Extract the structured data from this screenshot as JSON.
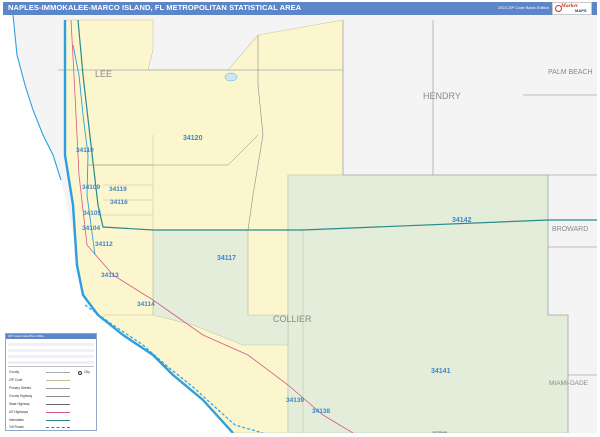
{
  "header": {
    "title": "NAPLES-IMMOKALEE-MARCO ISLAND, FL METROPOLITAN STATISTICAL AREA",
    "edition": "2023 ZIP Code Basic Edition",
    "logo_top": "Market",
    "logo_bottom": "MAPS"
  },
  "counties": {
    "lee": "LEE",
    "hendry": "HENDRY",
    "palm_beach": "PALM BEACH",
    "broward": "BROWARD",
    "collier": "COLLIER",
    "miami_dade": "MIAMI-DADE"
  },
  "zip_labels": {
    "z34120": "34120",
    "z34110": "34110",
    "z34109": "34109",
    "z34119": "34119",
    "z34116": "34116",
    "z34105": "34105",
    "z34104": "34104",
    "z34112": "34112",
    "z34113": "34113",
    "z34117": "34117",
    "z34142": "34142",
    "z34114": "34114",
    "z34141": "34141",
    "z34139": "34139",
    "z34138": "34138"
  },
  "legend": {
    "heading": "ZIP Code Index/Post Office",
    "rows": [
      "County",
      "ZIP Code",
      "Primary Streets",
      "County Highway",
      "State Highway",
      "US Highways",
      "Interstates",
      "Toll Roads"
    ],
    "city_label": "City"
  },
  "colors": {
    "header_blue": "#5d86c9",
    "zip_yellow": "#fbf6cd",
    "zip_green": "#e3edd9",
    "outside_gray": "#f4f4f4",
    "water": "#ffffff",
    "zip_label": "#3f86c8",
    "county_label": "#8a8a8a",
    "highway": "#2a8a8a",
    "coast": "#2d9fe0"
  },
  "footer": {
    "credit": "Full Roads"
  }
}
